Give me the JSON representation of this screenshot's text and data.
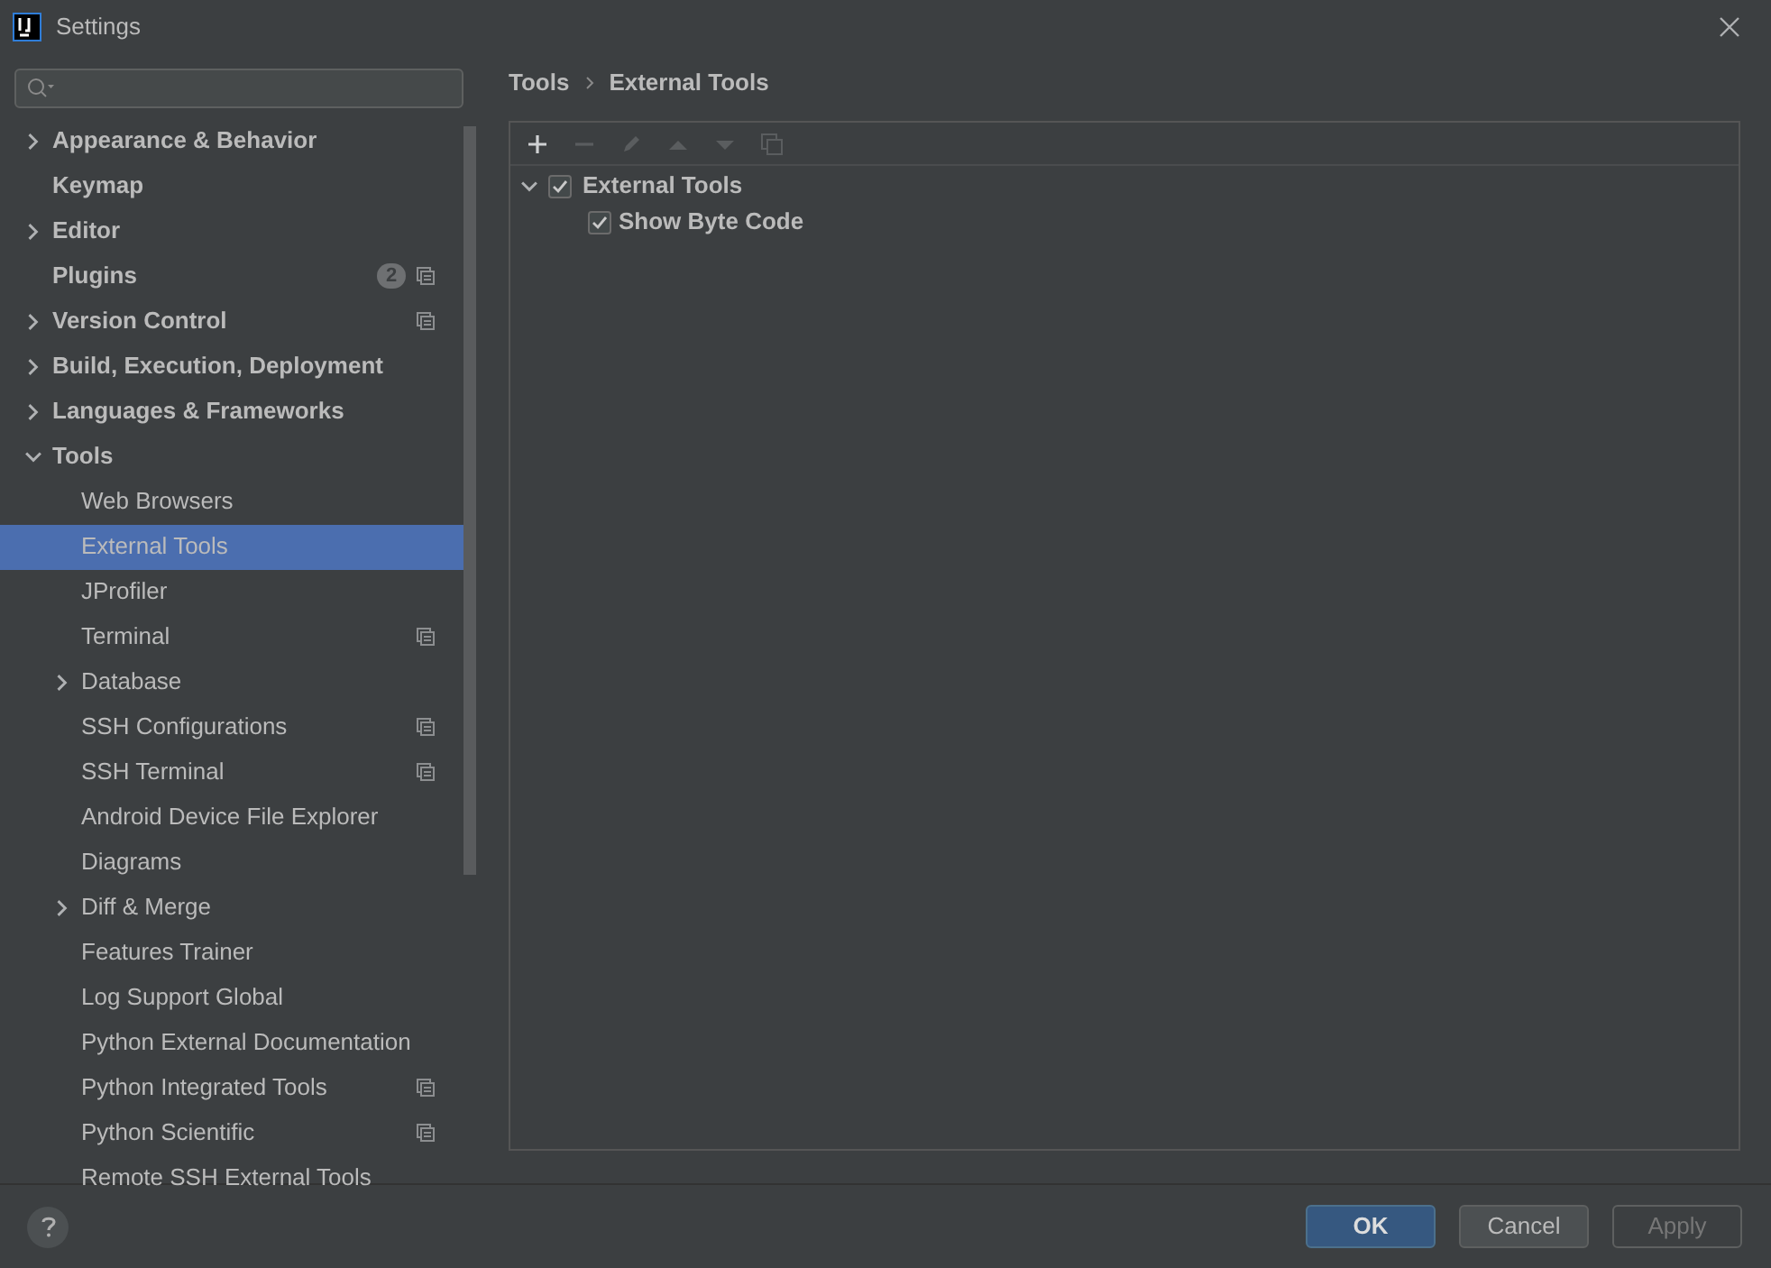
{
  "window": {
    "title": "Settings"
  },
  "sidebar": {
    "items": [
      {
        "label": "Appearance & Behavior",
        "expanded": false,
        "selected": false,
        "project_scoped": false
      },
      {
        "label": "Keymap",
        "selected": false,
        "project_scoped": false
      },
      {
        "label": "Editor",
        "expanded": false,
        "selected": false,
        "project_scoped": false
      },
      {
        "label": "Plugins",
        "selected": false,
        "project_scoped": true,
        "badge": "2"
      },
      {
        "label": "Version Control",
        "expanded": false,
        "selected": false,
        "project_scoped": true
      },
      {
        "label": "Build, Execution, Deployment",
        "expanded": false,
        "selected": false,
        "project_scoped": false
      },
      {
        "label": "Languages & Frameworks",
        "expanded": false,
        "selected": false,
        "project_scoped": false
      },
      {
        "label": "Tools",
        "expanded": true,
        "selected": false,
        "project_scoped": false,
        "children": [
          {
            "label": "Web Browsers",
            "selected": false,
            "project_scoped": false
          },
          {
            "label": "External Tools",
            "selected": true,
            "project_scoped": false
          },
          {
            "label": "JProfiler",
            "selected": false,
            "project_scoped": false
          },
          {
            "label": "Terminal",
            "selected": false,
            "project_scoped": true
          },
          {
            "label": "Database",
            "expanded": false,
            "selected": false,
            "project_scoped": false
          },
          {
            "label": "SSH Configurations",
            "selected": false,
            "project_scoped": true
          },
          {
            "label": "SSH Terminal",
            "selected": false,
            "project_scoped": true
          },
          {
            "label": "Android Device File Explorer",
            "selected": false,
            "project_scoped": false
          },
          {
            "label": "Diagrams",
            "selected": false,
            "project_scoped": false
          },
          {
            "label": "Diff & Merge",
            "expanded": false,
            "selected": false,
            "project_scoped": false
          },
          {
            "label": "Features Trainer",
            "selected": false,
            "project_scoped": false
          },
          {
            "label": "Log Support Global",
            "selected": false,
            "project_scoped": false
          },
          {
            "label": "Python External Documentation",
            "selected": false,
            "project_scoped": false
          },
          {
            "label": "Python Integrated Tools",
            "selected": false,
            "project_scoped": true
          },
          {
            "label": "Python Scientific",
            "selected": false,
            "project_scoped": true
          },
          {
            "label": "Remote SSH External Tools",
            "selected": false,
            "project_scoped": false
          }
        ]
      }
    ]
  },
  "breadcrumb": [
    "Tools",
    "External Tools"
  ],
  "toolbar": [
    {
      "kind": "add",
      "disabled": false
    },
    {
      "kind": "remove",
      "disabled": true
    },
    {
      "kind": "edit",
      "disabled": true
    },
    {
      "kind": "up",
      "disabled": true
    },
    {
      "kind": "down",
      "disabled": true
    },
    {
      "kind": "copy",
      "disabled": true
    }
  ],
  "tree": [
    {
      "label": "External Tools",
      "checked": true,
      "expanded": true,
      "children": [
        {
          "label": "Show Byte Code",
          "checked": true
        }
      ]
    }
  ],
  "buttons": [
    {
      "label": "OK",
      "kind": "primary",
      "disabled": false
    },
    {
      "label": "Cancel",
      "kind": "normal",
      "disabled": false
    },
    {
      "label": "Apply",
      "kind": "normal",
      "disabled": true
    }
  ]
}
